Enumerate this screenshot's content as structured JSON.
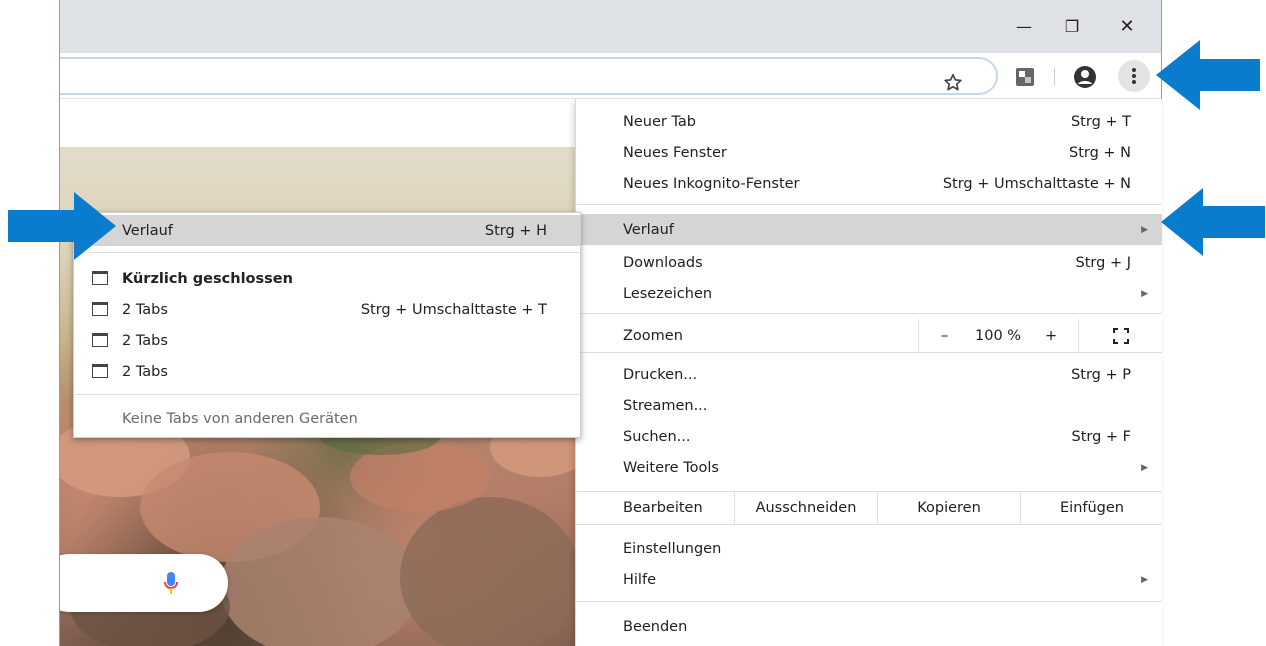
{
  "window": {
    "controls": {
      "minimize": "—",
      "restore": "❐",
      "close": "✕"
    }
  },
  "main_menu": {
    "items_top": [
      {
        "label": "Neuer Tab",
        "shortcut": "Strg + T"
      },
      {
        "label": "Neues Fenster",
        "shortcut": "Strg + N"
      },
      {
        "label": "Neues Inkognito-Fenster",
        "shortcut": "Strg + Umschalttaste + N"
      }
    ],
    "history": {
      "label": "Verlauf"
    },
    "downloads": {
      "label": "Downloads",
      "shortcut": "Strg + J"
    },
    "bookmarks": {
      "label": "Lesezeichen"
    },
    "zoom": {
      "label": "Zoomen",
      "minus": "–",
      "value": "100 %",
      "plus": "+"
    },
    "print": {
      "label": "Drucken...",
      "shortcut": "Strg + P"
    },
    "cast": {
      "label": "Streamen..."
    },
    "find": {
      "label": "Suchen...",
      "shortcut": "Strg + F"
    },
    "more_tools": {
      "label": "Weitere Tools"
    },
    "edit": {
      "label": "Bearbeiten",
      "cut": "Ausschneiden",
      "copy": "Kopieren",
      "paste": "Einfügen"
    },
    "settings": {
      "label": "Einstellungen"
    },
    "help": {
      "label": "Hilfe"
    },
    "exit": {
      "label": "Beenden"
    }
  },
  "history_submenu": {
    "header": {
      "label": "Verlauf",
      "shortcut": "Strg + H"
    },
    "recently_closed": "Kürzlich geschlossen",
    "tabs": [
      {
        "label": "2 Tabs",
        "shortcut": "Strg + Umschalttaste + T"
      },
      {
        "label": "2 Tabs",
        "shortcut": ""
      },
      {
        "label": "2 Tabs",
        "shortcut": ""
      }
    ],
    "no_other_devices": "Keine Tabs von anderen Geräten"
  },
  "colors": {
    "accent_arrow": "#0a7ccd",
    "highlight": "#d5d5d5",
    "titlebar": "#dee1e6"
  }
}
